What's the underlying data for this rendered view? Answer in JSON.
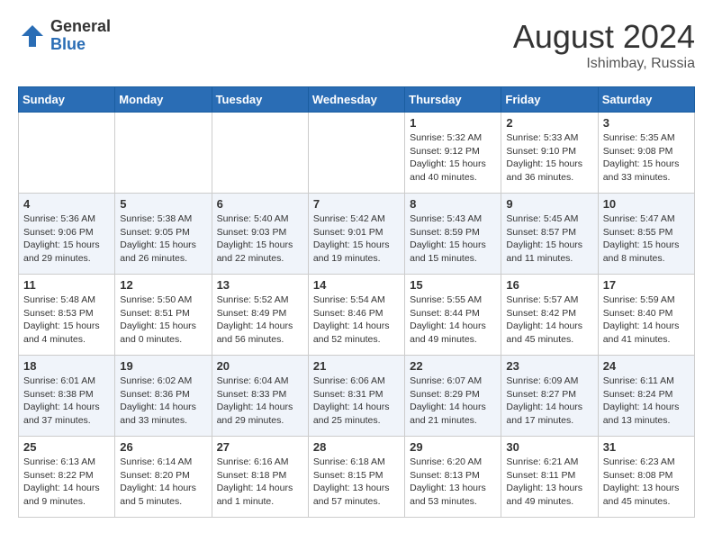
{
  "header": {
    "logo_general": "General",
    "logo_blue": "Blue",
    "month_title": "August 2024",
    "location": "Ishimbay, Russia"
  },
  "weekdays": [
    "Sunday",
    "Monday",
    "Tuesday",
    "Wednesday",
    "Thursday",
    "Friday",
    "Saturday"
  ],
  "weeks": [
    [
      {
        "day": "",
        "info": ""
      },
      {
        "day": "",
        "info": ""
      },
      {
        "day": "",
        "info": ""
      },
      {
        "day": "",
        "info": ""
      },
      {
        "day": "1",
        "info": "Sunrise: 5:32 AM\nSunset: 9:12 PM\nDaylight: 15 hours\nand 40 minutes."
      },
      {
        "day": "2",
        "info": "Sunrise: 5:33 AM\nSunset: 9:10 PM\nDaylight: 15 hours\nand 36 minutes."
      },
      {
        "day": "3",
        "info": "Sunrise: 5:35 AM\nSunset: 9:08 PM\nDaylight: 15 hours\nand 33 minutes."
      }
    ],
    [
      {
        "day": "4",
        "info": "Sunrise: 5:36 AM\nSunset: 9:06 PM\nDaylight: 15 hours\nand 29 minutes."
      },
      {
        "day": "5",
        "info": "Sunrise: 5:38 AM\nSunset: 9:05 PM\nDaylight: 15 hours\nand 26 minutes."
      },
      {
        "day": "6",
        "info": "Sunrise: 5:40 AM\nSunset: 9:03 PM\nDaylight: 15 hours\nand 22 minutes."
      },
      {
        "day": "7",
        "info": "Sunrise: 5:42 AM\nSunset: 9:01 PM\nDaylight: 15 hours\nand 19 minutes."
      },
      {
        "day": "8",
        "info": "Sunrise: 5:43 AM\nSunset: 8:59 PM\nDaylight: 15 hours\nand 15 minutes."
      },
      {
        "day": "9",
        "info": "Sunrise: 5:45 AM\nSunset: 8:57 PM\nDaylight: 15 hours\nand 11 minutes."
      },
      {
        "day": "10",
        "info": "Sunrise: 5:47 AM\nSunset: 8:55 PM\nDaylight: 15 hours\nand 8 minutes."
      }
    ],
    [
      {
        "day": "11",
        "info": "Sunrise: 5:48 AM\nSunset: 8:53 PM\nDaylight: 15 hours\nand 4 minutes."
      },
      {
        "day": "12",
        "info": "Sunrise: 5:50 AM\nSunset: 8:51 PM\nDaylight: 15 hours\nand 0 minutes."
      },
      {
        "day": "13",
        "info": "Sunrise: 5:52 AM\nSunset: 8:49 PM\nDaylight: 14 hours\nand 56 minutes."
      },
      {
        "day": "14",
        "info": "Sunrise: 5:54 AM\nSunset: 8:46 PM\nDaylight: 14 hours\nand 52 minutes."
      },
      {
        "day": "15",
        "info": "Sunrise: 5:55 AM\nSunset: 8:44 PM\nDaylight: 14 hours\nand 49 minutes."
      },
      {
        "day": "16",
        "info": "Sunrise: 5:57 AM\nSunset: 8:42 PM\nDaylight: 14 hours\nand 45 minutes."
      },
      {
        "day": "17",
        "info": "Sunrise: 5:59 AM\nSunset: 8:40 PM\nDaylight: 14 hours\nand 41 minutes."
      }
    ],
    [
      {
        "day": "18",
        "info": "Sunrise: 6:01 AM\nSunset: 8:38 PM\nDaylight: 14 hours\nand 37 minutes."
      },
      {
        "day": "19",
        "info": "Sunrise: 6:02 AM\nSunset: 8:36 PM\nDaylight: 14 hours\nand 33 minutes."
      },
      {
        "day": "20",
        "info": "Sunrise: 6:04 AM\nSunset: 8:33 PM\nDaylight: 14 hours\nand 29 minutes."
      },
      {
        "day": "21",
        "info": "Sunrise: 6:06 AM\nSunset: 8:31 PM\nDaylight: 14 hours\nand 25 minutes."
      },
      {
        "day": "22",
        "info": "Sunrise: 6:07 AM\nSunset: 8:29 PM\nDaylight: 14 hours\nand 21 minutes."
      },
      {
        "day": "23",
        "info": "Sunrise: 6:09 AM\nSunset: 8:27 PM\nDaylight: 14 hours\nand 17 minutes."
      },
      {
        "day": "24",
        "info": "Sunrise: 6:11 AM\nSunset: 8:24 PM\nDaylight: 14 hours\nand 13 minutes."
      }
    ],
    [
      {
        "day": "25",
        "info": "Sunrise: 6:13 AM\nSunset: 8:22 PM\nDaylight: 14 hours\nand 9 minutes."
      },
      {
        "day": "26",
        "info": "Sunrise: 6:14 AM\nSunset: 8:20 PM\nDaylight: 14 hours\nand 5 minutes."
      },
      {
        "day": "27",
        "info": "Sunrise: 6:16 AM\nSunset: 8:18 PM\nDaylight: 14 hours\nand 1 minute."
      },
      {
        "day": "28",
        "info": "Sunrise: 6:18 AM\nSunset: 8:15 PM\nDaylight: 13 hours\nand 57 minutes."
      },
      {
        "day": "29",
        "info": "Sunrise: 6:20 AM\nSunset: 8:13 PM\nDaylight: 13 hours\nand 53 minutes."
      },
      {
        "day": "30",
        "info": "Sunrise: 6:21 AM\nSunset: 8:11 PM\nDaylight: 13 hours\nand 49 minutes."
      },
      {
        "day": "31",
        "info": "Sunrise: 6:23 AM\nSunset: 8:08 PM\nDaylight: 13 hours\nand 45 minutes."
      }
    ]
  ]
}
